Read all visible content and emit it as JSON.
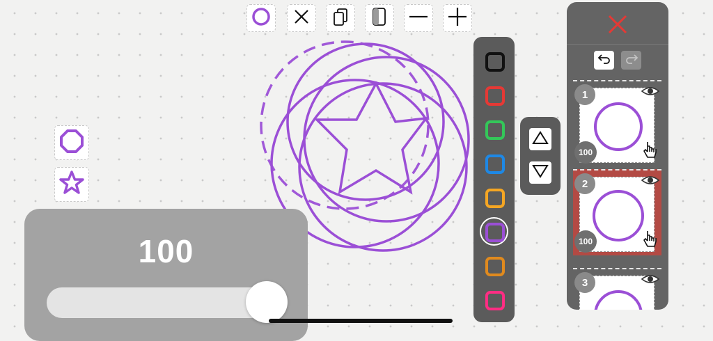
{
  "toolbar": {
    "items": [
      {
        "icon": "circle-shape-icon"
      },
      {
        "icon": "close-icon"
      },
      {
        "icon": "duplicate-icon"
      },
      {
        "icon": "split-icon"
      },
      {
        "icon": "minus-icon"
      },
      {
        "icon": "plus-icon"
      }
    ]
  },
  "shapes_panel": {
    "items": [
      {
        "icon": "circle-shape-icon"
      },
      {
        "icon": "star-shape-icon"
      }
    ]
  },
  "opacity": {
    "value": "100",
    "slider_level": 1.0
  },
  "palette": {
    "colors": [
      "#111111",
      "#e53935",
      "#34c759",
      "#1e88e5",
      "#f5a623",
      "#9b4fd6",
      "#e08a1e",
      "#ff2d83"
    ],
    "selected_index": 5
  },
  "accent_color": "#9b4fd6",
  "layers": {
    "items": [
      {
        "number": "1",
        "opacity": "100"
      },
      {
        "number": "2",
        "opacity": "100"
      },
      {
        "number": "3"
      }
    ],
    "selected_index": 1
  }
}
